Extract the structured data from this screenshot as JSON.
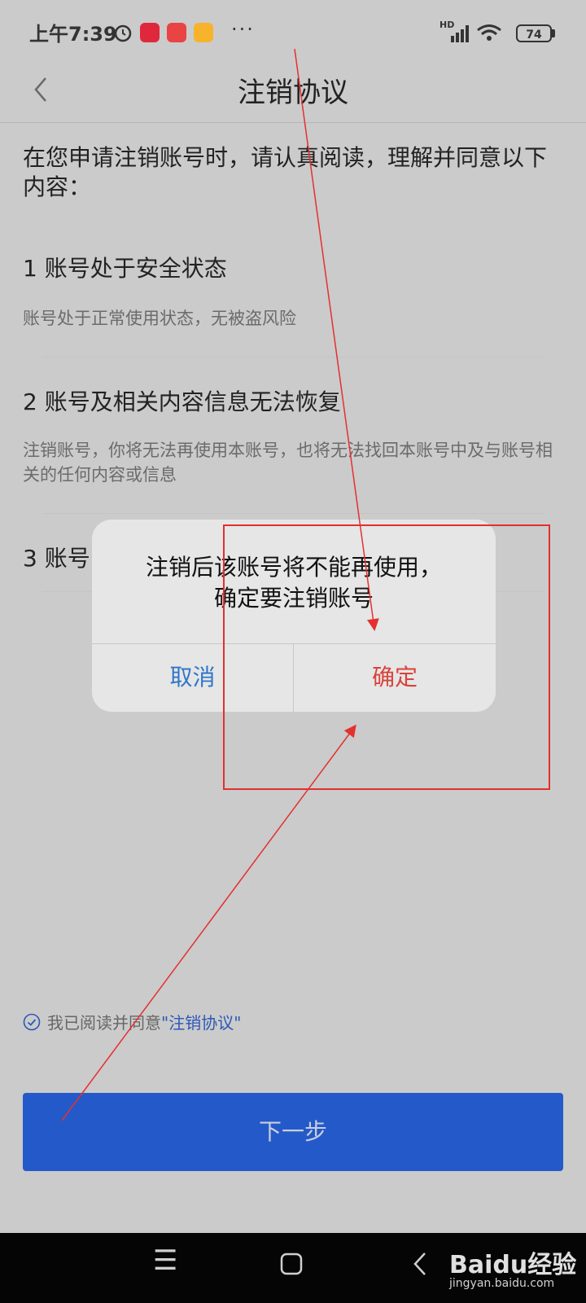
{
  "status_bar": {
    "time": "上午7:39",
    "dots": "···",
    "network": "HD",
    "battery": "74"
  },
  "header": {
    "title": "注销协议"
  },
  "intro": "在您申请注销账号时，请认真阅读，理解并同意以下内容：",
  "sections": [
    {
      "title": "1  账号处于安全状态",
      "desc": "账号处于正常使用状态，无被盗风险"
    },
    {
      "title": "2  账号及相关内容信息无法恢复",
      "desc": "注销账号，你将无法再使用本账号，也将无法找回本账号中及与账号相关的任何内容或信息"
    },
    {
      "title": "3  账号",
      "desc": ""
    }
  ],
  "agreement": {
    "prefix": "我已阅读并同意",
    "link": "\"注销协议\""
  },
  "next_button": "下一步",
  "dialog": {
    "line1": "注销后该账号将不能再使用，",
    "line2": "确定要注销账号",
    "cancel": "取消",
    "confirm": "确定"
  },
  "watermark": {
    "brand": "Baidu经验",
    "url": "jingyan.baidu.com"
  },
  "colors": {
    "accent_blue": "#2459c9",
    "confirm_red": "#d8433b",
    "cancel_blue": "#2f76c9",
    "annotation_red": "#e03030"
  }
}
